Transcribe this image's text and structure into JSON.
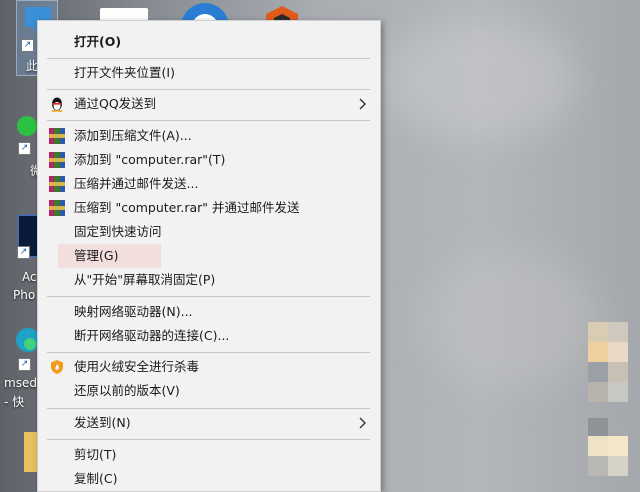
{
  "desktop": {
    "icon_labels": {
      "pc_label": "此",
      "wechat_label": "微",
      "adobe_label": "Ac",
      "adobe_label2": "Pho",
      "edge_label": "msed",
      "edge_label2": "- 快"
    }
  },
  "menu": {
    "items": [
      {
        "label": "打开(O)"
      },
      {
        "label": "打开文件夹位置(I)"
      },
      {
        "label": "通过QQ发送到"
      },
      {
        "label": "添加到压缩文件(A)..."
      },
      {
        "label": "添加到 \"computer.rar\"(T)"
      },
      {
        "label": "压缩并通过邮件发送..."
      },
      {
        "label": "压缩到 \"computer.rar\" 并通过邮件发送"
      },
      {
        "label": "固定到快速访问"
      },
      {
        "label": "管理(G)"
      },
      {
        "label": "从\"开始\"屏幕取消固定(P)"
      },
      {
        "label": "映射网络驱动器(N)..."
      },
      {
        "label": "断开网络驱动器的连接(C)..."
      },
      {
        "label": "使用火绒安全进行杀毒"
      },
      {
        "label": "还原以前的版本(V)"
      },
      {
        "label": "发送到(N)"
      },
      {
        "label": "剪切(T)"
      },
      {
        "label": "复制(C)"
      }
    ]
  },
  "colors": {
    "menu_bg": "#f2f2f2",
    "hover_bg": "#f3dede",
    "separator": "#c8c8c8"
  }
}
